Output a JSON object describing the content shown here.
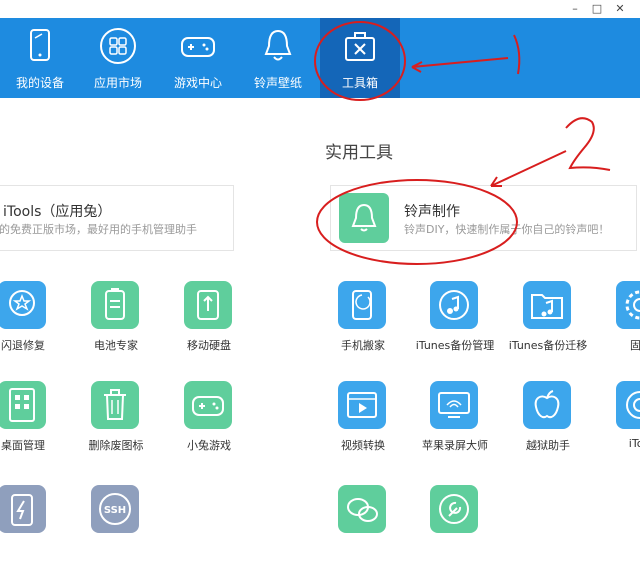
{
  "window": {
    "minimize": "–",
    "maximize": "□",
    "close": "✕"
  },
  "nav": {
    "items": [
      {
        "label": "我的设备",
        "icon": "tablet-icon"
      },
      {
        "label": "应用市场",
        "icon": "app-grid-icon"
      },
      {
        "label": "游戏中心",
        "icon": "gamepad-icon"
      },
      {
        "label": "铃声壁纸",
        "icon": "bell-icon"
      },
      {
        "label": "工具箱",
        "icon": "toolbox-icon",
        "active": true
      }
    ]
  },
  "section": {
    "title": "实用工具"
  },
  "cards": {
    "left": {
      "title": "iTools（应用兔）",
      "desc": "的免费正版市场，最好用的手机管理助手"
    },
    "right": {
      "title": "铃声制作",
      "desc": "铃声DIY，快速制作属于你自己的铃声吧！"
    }
  },
  "tools_left": [
    {
      "label": "闪退修复",
      "color": "blue",
      "icon": "star-badge-icon"
    },
    {
      "label": "电池专家",
      "color": "green",
      "icon": "battery-icon"
    },
    {
      "label": "移动硬盘",
      "color": "green",
      "icon": "usb-drive-icon"
    },
    {
      "label": "桌面管理",
      "color": "green",
      "icon": "desktop-grid-icon"
    },
    {
      "label": "删除废图标",
      "color": "green",
      "icon": "trash-icon"
    },
    {
      "label": "小兔游戏",
      "color": "green",
      "icon": "game-icon"
    },
    {
      "label": "",
      "color": "gray",
      "icon": "flash-icon"
    },
    {
      "label": "",
      "color": "gray",
      "icon": "ssh-icon",
      "text": "SSH"
    }
  ],
  "tools_right": [
    {
      "label": "手机搬家",
      "color": "blue",
      "icon": "phone-transfer-icon"
    },
    {
      "label": "iTunes备份管理",
      "color": "blue",
      "icon": "music-refresh-icon"
    },
    {
      "label": "iTunes备份迁移",
      "color": "blue",
      "icon": "music-folder-icon"
    },
    {
      "label": "固件",
      "color": "blue",
      "icon": "gear-icon"
    },
    {
      "label": "视频转换",
      "color": "blue",
      "icon": "video-icon"
    },
    {
      "label": "苹果录屏大师",
      "color": "blue",
      "icon": "screen-record-icon"
    },
    {
      "label": "越狱助手",
      "color": "blue",
      "icon": "apple-icon"
    },
    {
      "label": "iTool",
      "color": "blue",
      "icon": "itools-icon"
    },
    {
      "label": "",
      "color": "green",
      "icon": "wechat-icon"
    },
    {
      "label": "",
      "color": "green",
      "icon": "wrench-icon"
    }
  ],
  "annotations": {
    "one": "1",
    "two": "2"
  }
}
